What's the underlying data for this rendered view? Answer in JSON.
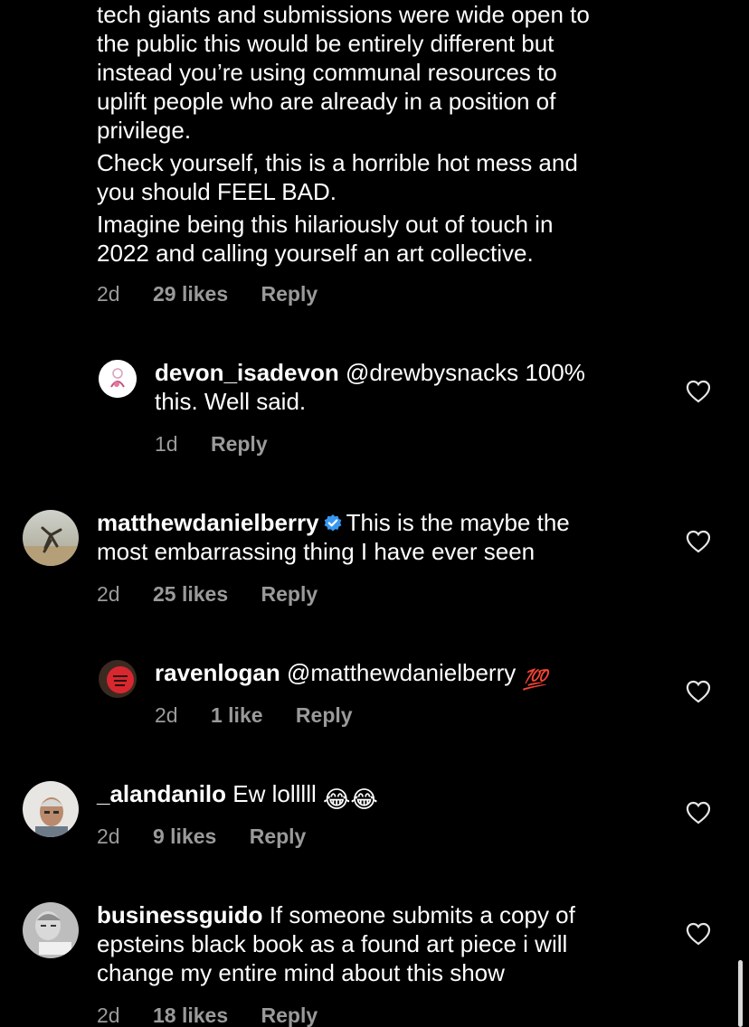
{
  "comments": [
    {
      "id": "drewbysnacks",
      "text_lines": [
        "tech giants and submissions were wide open to",
        "the public this would be entirely different but",
        "instead you’re using communal resources to",
        "uplift people who are already in a position of",
        "privilege.",
        "Check yourself, this is a horrible hot mess and",
        "you should FEEL BAD.",
        "Imagine being this hilariously out of touch in",
        "2022 and calling yourself an art collective."
      ],
      "time": "2d",
      "likes": "29 likes",
      "reply": "Reply"
    },
    {
      "id": "devon",
      "username": "devon_isadevon",
      "mention": "@drewbysnacks",
      "text_first": "100%",
      "text_second": "this. Well said.",
      "time": "1d",
      "reply": "Reply"
    },
    {
      "id": "matthew",
      "username": "matthewdanielberry",
      "text_first": "This is the maybe the",
      "text_second": "most embarrassing thing I have ever seen",
      "time": "2d",
      "likes": "25 likes",
      "reply": "Reply"
    },
    {
      "id": "raven",
      "username": "ravenlogan",
      "mention": "@matthewdanielberry",
      "emoji": "💯",
      "time": "2d",
      "likes": "1 like",
      "reply": "Reply"
    },
    {
      "id": "alan",
      "username": "_alandanilo",
      "text_first": "Ew lolllll",
      "emoji": "😂😂",
      "time": "2d",
      "likes": "9 likes",
      "reply": "Reply"
    },
    {
      "id": "guido",
      "username": "businessguido",
      "text_first": "If someone submits a copy of",
      "text_second": "epsteins black book as a found art piece i will",
      "text_third": "change my entire mind about this show",
      "time": "2d",
      "likes": "18 likes",
      "reply": "Reply"
    }
  ],
  "icons": {
    "heart": "heart-outline-icon",
    "verified": "verified-badge-icon"
  },
  "colors": {
    "background": "#000000",
    "text": "#ffffff",
    "secondary": "#9a9a9a",
    "verified": "#3897f0"
  }
}
